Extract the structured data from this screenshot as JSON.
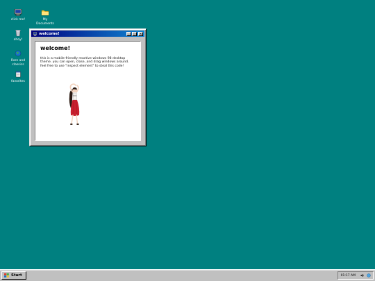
{
  "desktop": {
    "icons": [
      {
        "name": "click me!",
        "icon": "computer-icon"
      },
      {
        "name": "My\nDocuments",
        "icon": "folder-icon"
      },
      {
        "name": "ahoy!",
        "icon": "recycle-bin-icon"
      },
      {
        "name": "Rare and\nclassics",
        "icon": "globe-icon"
      },
      {
        "name": "favorites",
        "icon": "notepad-icon"
      }
    ]
  },
  "window": {
    "title": "welcome!",
    "title_icon": "computer-icon",
    "controls": {
      "minimize": "_",
      "maximize": "□",
      "close": "×"
    },
    "heading": "welcome!",
    "body": "this is a mobile-friendly reactive windows 98 desktop theme. you can open, close, and drag windows around. feel free to use \"inspect element\" to steal this code!",
    "image": "dancing-girl-illustration"
  },
  "taskbar": {
    "start_label": "Start",
    "clock": "01:17 AM",
    "tray_icons": [
      "volume-icon",
      "network-icon"
    ]
  },
  "colors": {
    "desktop": "#008080",
    "titlebar_start": "#000080",
    "titlebar_end": "#1084d0",
    "chrome": "#c0c0c0"
  }
}
